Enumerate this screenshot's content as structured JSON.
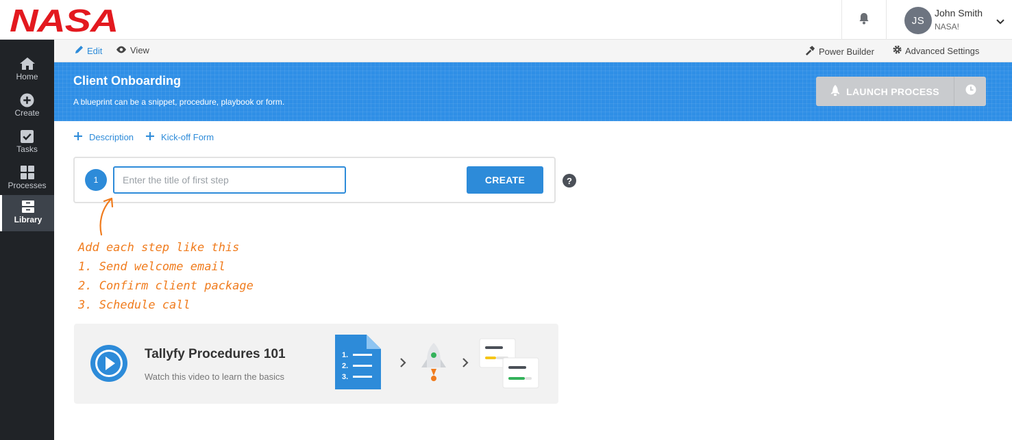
{
  "brand": {
    "logo_text": "NASA",
    "logo_color": "#e3191f"
  },
  "header": {
    "user_initials": "JS",
    "user_name": "John Smith",
    "user_org": "NASA!"
  },
  "sidebar": {
    "items": [
      {
        "label": "Home",
        "icon": "home-icon"
      },
      {
        "label": "Create",
        "icon": "plus-circle-icon"
      },
      {
        "label": "Tasks",
        "icon": "checkbox-icon"
      },
      {
        "label": "Processes",
        "icon": "grid-icon"
      },
      {
        "label": "Library",
        "icon": "archive-icon",
        "active": true
      }
    ]
  },
  "subbar": {
    "edit_label": "Edit",
    "view_label": "View",
    "power_builder_label": "Power Builder",
    "advanced_settings_label": "Advanced Settings"
  },
  "banner": {
    "title": "Client Onboarding",
    "subtitle": "A blueprint can be a snippet, procedure, playbook or form.",
    "launch_label": "LAUNCH PROCESS",
    "accent_color": "#2f8fe6"
  },
  "adders": {
    "description_label": "Description",
    "kickoff_label": "Kick-off Form"
  },
  "step_editor": {
    "step_number": "1",
    "input_value": "",
    "input_placeholder": "Enter the title of first step",
    "create_label": "CREATE",
    "help_label": "?"
  },
  "hint": {
    "lines": [
      "Add each step like this",
      "1. Send welcome email",
      "2. Confirm client package",
      "3. Schedule call"
    ],
    "color": "#f07c1e"
  },
  "video": {
    "title": "Tallyfy Procedures 101",
    "subtitle": "Watch this video to learn the basics",
    "list_numbers": [
      "1.",
      "2.",
      "3."
    ]
  }
}
